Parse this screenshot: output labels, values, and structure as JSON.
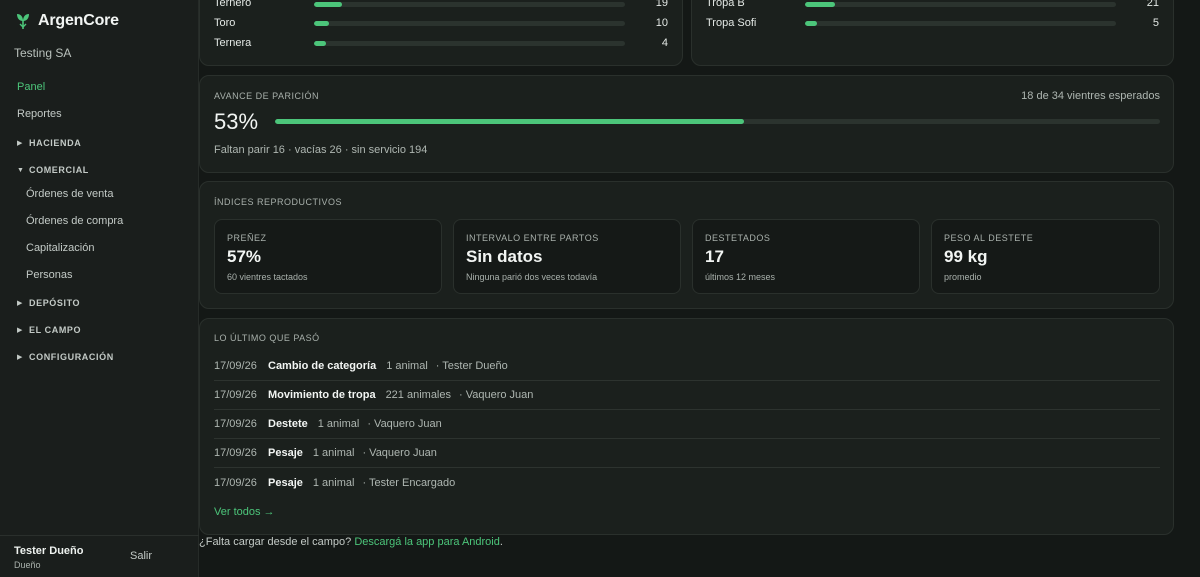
{
  "sidebar": {
    "brand": "ArgenCore",
    "org": "Testing SA",
    "links": [
      {
        "label": "Panel",
        "active": true
      },
      {
        "label": "Reportes",
        "active": false
      }
    ],
    "groups": {
      "hacienda": "HACIENDA",
      "comercial": "COMERCIAL",
      "deposito": "DEPÓSITO",
      "campo": "EL CAMPO",
      "config": "CONFIGURACIÓN"
    },
    "comercial_items": [
      "Órdenes de venta",
      "Órdenes de compra",
      "Capitalización",
      "Personas"
    ],
    "user": {
      "name": "Tester Dueño",
      "role": "Dueño",
      "logout": "Salir"
    }
  },
  "categories_card": {
    "rows": [
      {
        "label": "Ternero",
        "value": "19",
        "pct": 0.09
      },
      {
        "label": "Toro",
        "value": "10",
        "pct": 0.048
      },
      {
        "label": "Ternera",
        "value": "4",
        "pct": 0.04
      }
    ]
  },
  "tropas_card": {
    "rows": [
      {
        "label": "Tropa B",
        "value": "21",
        "pct": 0.095
      },
      {
        "label": "Tropa Sofi",
        "value": "5",
        "pct": 0.04
      }
    ]
  },
  "paricion": {
    "label": "AVANCE DE PARICIÓN",
    "caption": "18 de 34 vientres esperados",
    "percent_text": "53%",
    "percent": 0.53,
    "detail": "Faltan parir 16 · vacías 26 · sin servicio 194"
  },
  "indices": {
    "label": "ÍNDICES REPRODUCTIVOS",
    "kpis": [
      {
        "label": "PREÑEZ",
        "value": "57%",
        "sub": "60 vientres tactados"
      },
      {
        "label": "INTERVALO ENTRE PARTOS",
        "value": "Sin datos",
        "sub": "Ninguna parió dos veces todavía"
      },
      {
        "label": "DESTETADOS",
        "value": "17",
        "sub": "últimos 12 meses"
      },
      {
        "label": "PESO AL DESTETE",
        "value": "99 kg",
        "sub": "promedio"
      }
    ]
  },
  "recent": {
    "label": "LO ÚLTIMO QUE PASÓ",
    "events": [
      {
        "date": "17/09/26",
        "type": "Cambio de categoría",
        "count": "1 animal",
        "user": "· Tester Dueño"
      },
      {
        "date": "17/09/26",
        "type": "Movimiento de tropa",
        "count": "221 animales",
        "user": "· Vaquero Juan"
      },
      {
        "date": "17/09/26",
        "type": "Destete",
        "count": "1 animal",
        "user": "· Vaquero Juan"
      },
      {
        "date": "17/09/26",
        "type": "Pesaje",
        "count": "1 animal",
        "user": "· Vaquero Juan"
      },
      {
        "date": "17/09/26",
        "type": "Pesaje",
        "count": "1 animal",
        "user": "· Tester Encargado"
      }
    ],
    "see_all": "Ver todos →"
  },
  "footer": {
    "question": "¿Falta cargar desde el campo? ",
    "link": "Descargá la app para Android",
    "end": "."
  },
  "colors": {
    "accent": "#4cc57a",
    "background": "#141816",
    "card": "#1b201d"
  }
}
